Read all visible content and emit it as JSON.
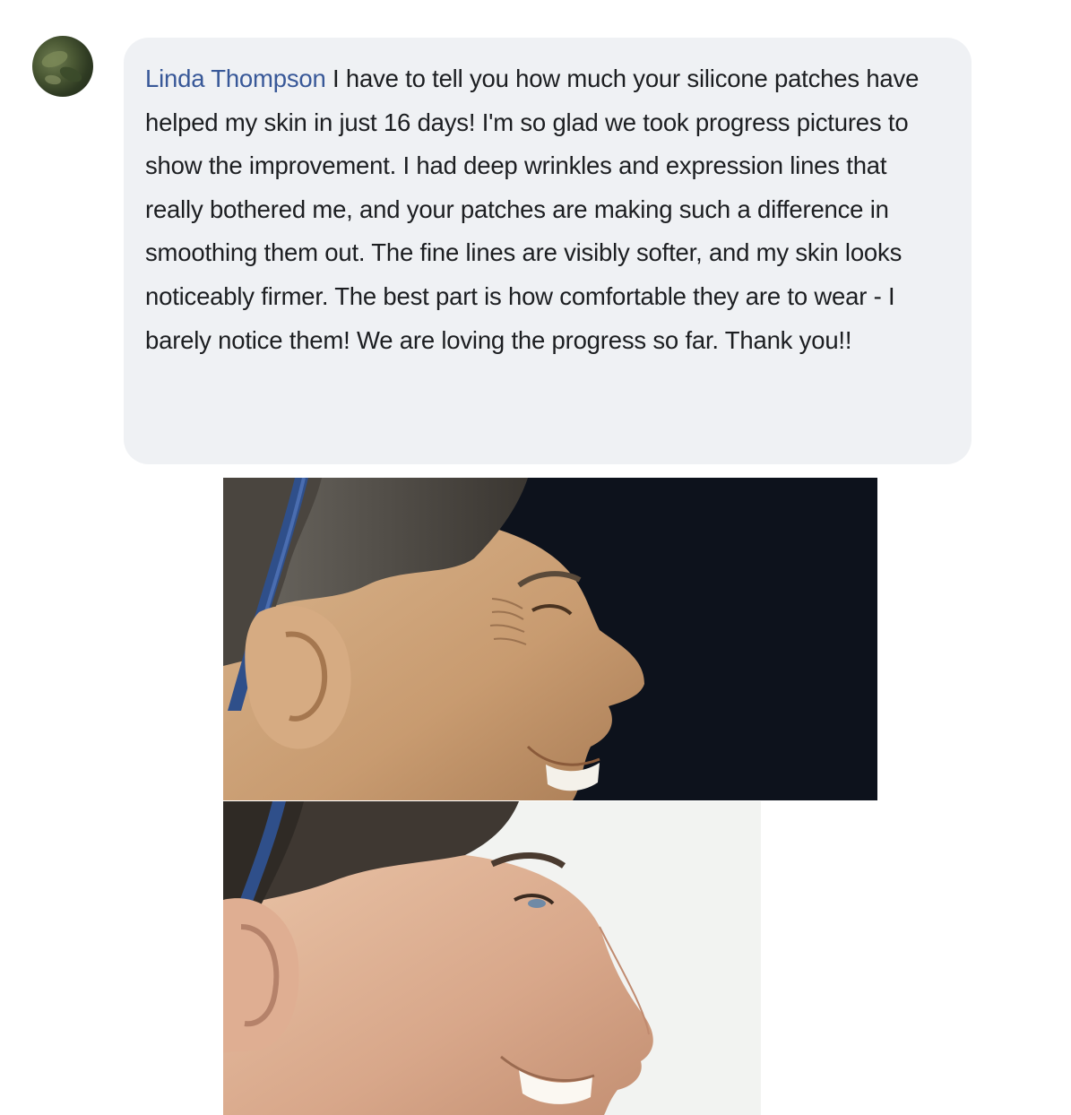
{
  "comment": {
    "author": "Linda Thompson",
    "text": "I have to tell you how much your silicone patches have helped my skin in just 16 days! I'm so glad we took progress pictures to show the improvement. I had deep wrinkles and expression lines that really bothered me, and your patches are making such a difference in smoothing them out. The fine lines are visibly softer, and my skin looks noticeably firmer. The best part is how comfortable they are to wear - I barely notice them! We are loving the progress so far. Thank you!!",
    "avatar_icon": "profile-photo-avatar"
  },
  "photos": {
    "before": {
      "icon": "before-profile-photo"
    },
    "after": {
      "icon": "after-profile-photo"
    }
  },
  "colors": {
    "author_link": "#385898",
    "bubble_bg": "#eff1f4",
    "text": "#1c1e21",
    "before_backdrop": "#0d121c",
    "after_backdrop": "#f2f3f1"
  }
}
